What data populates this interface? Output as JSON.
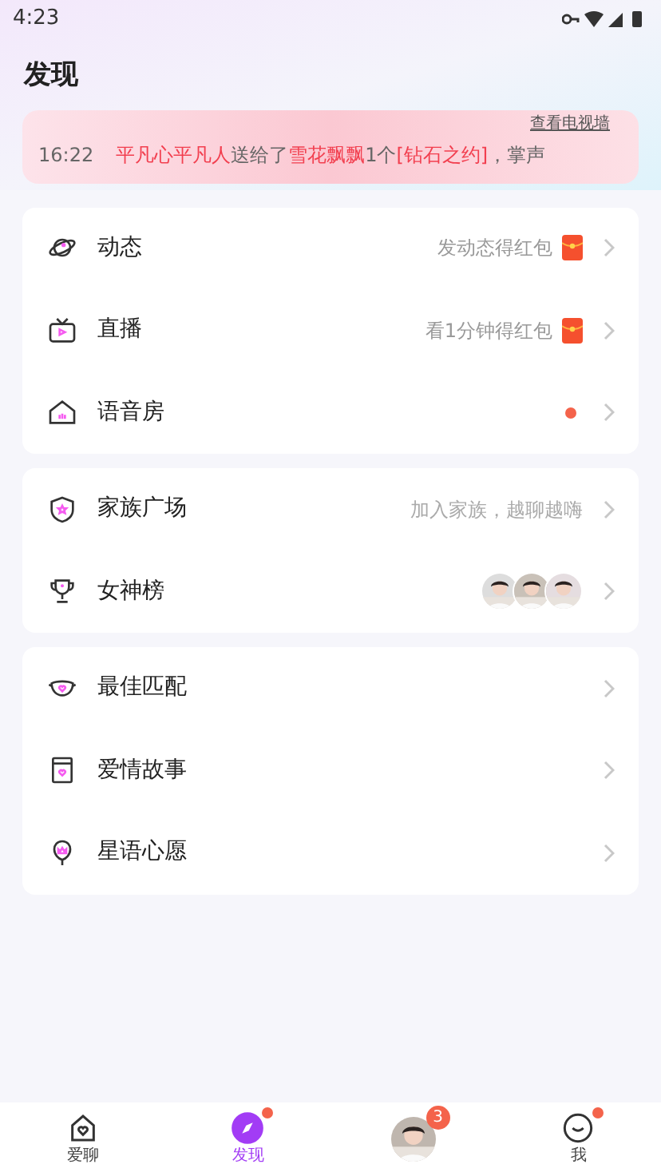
{
  "status_bar": {
    "time": "4:23"
  },
  "header": {
    "title": "发现"
  },
  "banner": {
    "link": "查看电视墙",
    "message": {
      "time": "16:22",
      "sender": "平凡心平凡人",
      "verb": "送给了",
      "receiver": "雪花飘飘",
      "count": "1个",
      "gift": "[钻石之约]",
      "tail": "，掌声"
    }
  },
  "groups": [
    {
      "items": [
        {
          "label": "动态",
          "hint": "发动态得红包",
          "kind": "red-packet"
        },
        {
          "label": "直播",
          "hint": "看1分钟得红包",
          "kind": "red-packet"
        },
        {
          "label": "语音房",
          "kind": "dot"
        }
      ]
    },
    {
      "items": [
        {
          "label": "家族广场",
          "hint": "加入家族，越聊越嗨",
          "kind": "text"
        },
        {
          "label": "女神榜",
          "kind": "avatars"
        }
      ]
    },
    {
      "items": [
        {
          "label": "最佳匹配",
          "kind": "text"
        },
        {
          "label": "爱情故事",
          "kind": "text"
        },
        {
          "label": "星语心愿",
          "kind": "text"
        }
      ]
    }
  ],
  "tabbar": [
    {
      "label": "爱聊",
      "selected": false,
      "dot": false
    },
    {
      "label": "发现",
      "selected": true,
      "dot": true
    },
    {
      "badge": "3",
      "selected": false,
      "dot": false
    },
    {
      "label": "我",
      "selected": false,
      "dot": true
    }
  ]
}
